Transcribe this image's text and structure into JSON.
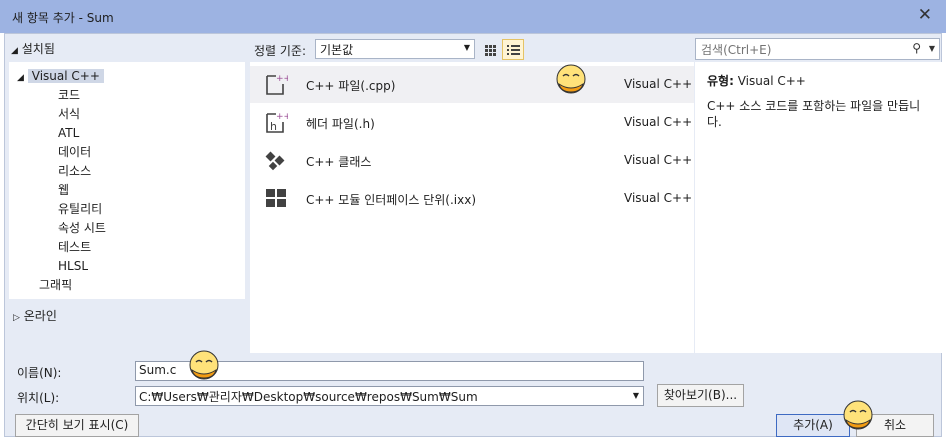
{
  "title": "새 항목 추가 - Sum",
  "left": {
    "installed": "설치됨",
    "tree": [
      "Visual C++",
      "코드",
      "서식",
      "ATL",
      "데이터",
      "리소스",
      "웹",
      "유틸리티",
      "속성 시트",
      "테스트",
      "HLSL",
      "그래픽"
    ],
    "online": "온라인"
  },
  "sort": {
    "label": "정렬 기준:",
    "value": "기본값"
  },
  "search": {
    "placeholder": "검색(Ctrl+E)"
  },
  "templates": [
    {
      "name": "C++ 파일(.cpp)",
      "type": "Visual C++",
      "icon": "cpp-file-icon"
    },
    {
      "name": "헤더 파일(.h)",
      "type": "Visual C++",
      "icon": "header-file-icon"
    },
    {
      "name": "C++ 클래스",
      "type": "Visual C++",
      "icon": "cpp-class-icon"
    },
    {
      "name": "C++ 모듈 인터페이스 단위(.ixx)",
      "type": "Visual C++",
      "icon": "module-interface-icon"
    }
  ],
  "details": {
    "type_label": "유형:",
    "type_value": "Visual C++",
    "description": "C++ 소스 코드를 포함하는 파일을 만듭니다."
  },
  "name_field": {
    "label": "이름(N):",
    "value": "Sum.c"
  },
  "location_field": {
    "label": "위치(L):",
    "value": "C:₩Users₩관리자₩Desktop₩source₩repos₩Sum₩Sum"
  },
  "buttons": {
    "browse": "찾아보기(B)...",
    "compact": "간단히 보기 표시(C)",
    "add": "추가(A)",
    "cancel": "취소"
  },
  "colors": {
    "accent": "#3e6ac2",
    "titlebar": "#9db3e2",
    "dialog_bg": "#e6ebf5",
    "purple_icon": "#9b4f96"
  }
}
